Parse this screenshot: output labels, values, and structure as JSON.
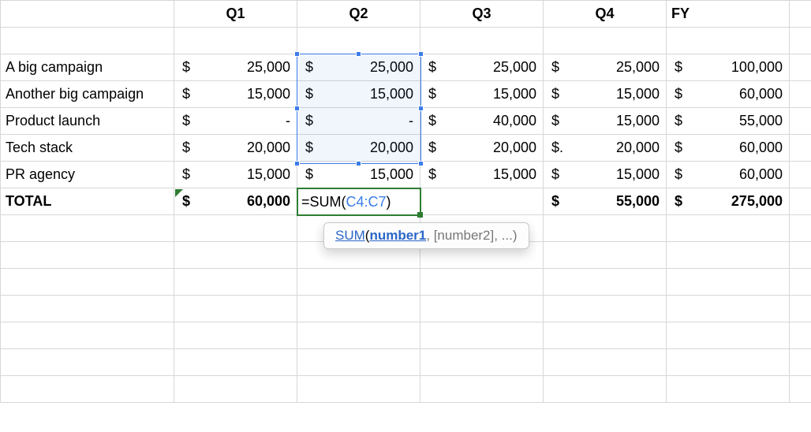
{
  "headers": {
    "q1": "Q1",
    "q2": "Q2",
    "q3": "Q3",
    "q4": "Q4",
    "fy": "FY"
  },
  "rows": [
    {
      "label": "A big campaign",
      "q1": "25,000",
      "q2": "25,000",
      "q3": "25,000",
      "q4": "25,000",
      "fy": "100,000"
    },
    {
      "label": "Another big campaign",
      "q1": "15,000",
      "q2": "15,000",
      "q3": "15,000",
      "q4": "15,000",
      "fy": "60,000"
    },
    {
      "label": "Product launch",
      "q1": "-",
      "q2": "-",
      "q3": "40,000",
      "q4": "15,000",
      "fy": "55,000"
    },
    {
      "label": "Tech stack",
      "q1": "20,000",
      "q2": "20,000",
      "q3": "20,000",
      "q4": "20,000",
      "q4_sym": "$.",
      "fy": "60,000"
    },
    {
      "label": "PR agency",
      "q1": "15,000",
      "q2": "15,000",
      "q3": "15,000",
      "q4": "15,000",
      "fy": "60,000"
    }
  ],
  "total": {
    "label": "TOTAL",
    "q1": "60,000",
    "q4": "55,000",
    "fy": "275,000"
  },
  "currency": "$",
  "formula": {
    "text_eq": "=",
    "text_fn": "SUM",
    "text_open": "(",
    "text_ref": "C4:C7",
    "text_close": ")"
  },
  "tooltip": {
    "fn": "SUM",
    "open": "(",
    "arg1": "number1",
    "rest": ", [number2], ...)"
  },
  "chart_data": {
    "type": "table",
    "columns": [
      "",
      "Q1",
      "Q2",
      "Q3",
      "Q4",
      "FY"
    ],
    "rows": [
      [
        "A big campaign",
        25000,
        25000,
        25000,
        25000,
        100000
      ],
      [
        "Another big campaign",
        15000,
        15000,
        15000,
        15000,
        60000
      ],
      [
        "Product launch",
        0,
        0,
        40000,
        15000,
        55000
      ],
      [
        "Tech stack",
        20000,
        20000,
        20000,
        20000,
        60000
      ],
      [
        "PR agency",
        15000,
        15000,
        15000,
        15000,
        60000
      ],
      [
        "TOTAL",
        60000,
        null,
        null,
        55000,
        275000
      ]
    ],
    "active_formula": "=SUM(C4:C7)",
    "active_cell": "C9",
    "highlighted_range": "C4:C7"
  }
}
